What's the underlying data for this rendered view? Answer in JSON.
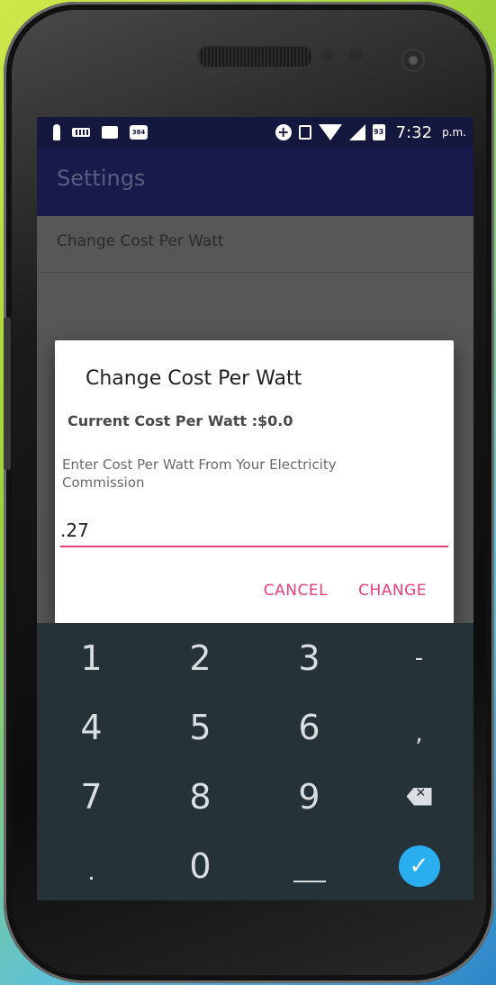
{
  "status_bar": {
    "calendar_day": "384",
    "battery_level": "93",
    "time": "7:32",
    "ampm": "p.m.",
    "icons_left": [
      "person-icon",
      "keyboard-icon",
      "image-icon",
      "calendar-icon"
    ],
    "icons_right": [
      "plus-circle-icon",
      "nfc-icon",
      "wifi-icon",
      "signal-icon",
      "battery-icon"
    ]
  },
  "app_bar": {
    "title": "Settings"
  },
  "preferences": {
    "item_label": "Change Cost Per Watt"
  },
  "dialog": {
    "title": "Change Cost Per Watt",
    "current_cost": "Current Cost Per Watt :$0.0",
    "hint": "Enter Cost Per Watt From Your Electricity Commission",
    "input_value": ".27",
    "cancel_label": "CANCEL",
    "change_label": "CHANGE",
    "accent_color": "#e7407b"
  },
  "keyboard": {
    "keys": [
      "1",
      "2",
      "3",
      "-",
      "4",
      "5",
      "6",
      ",",
      "7",
      "8",
      "9",
      ".",
      "0"
    ],
    "enter_color": "#29aef0",
    "background_color": "#253238"
  },
  "colors": {
    "status_bar": "#15183e",
    "app_bar": "#171a4a"
  }
}
